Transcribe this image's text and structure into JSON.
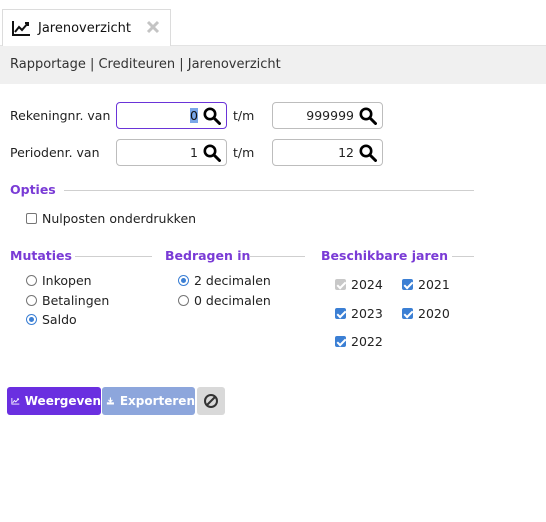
{
  "tab": {
    "title": "Jarenoverzicht",
    "icon": "chart-line-icon",
    "close_icon": "close-icon"
  },
  "breadcrumb": "Rapportage | Crediteuren | Jarenoverzicht",
  "filters": {
    "rekening": {
      "label": "Rekeningnr. van",
      "from": "0",
      "sep": "t/m",
      "to": "999999"
    },
    "periode": {
      "label": "Periodenr. van",
      "from": "1",
      "sep": "t/m",
      "to": "12"
    }
  },
  "opties": {
    "title": "Opties",
    "nulposten": {
      "label": "Nulposten onderdrukken",
      "checked": false
    }
  },
  "mutaties": {
    "title": "Mutaties",
    "options": [
      {
        "label": "Inkopen",
        "selected": false
      },
      {
        "label": "Betalingen",
        "selected": false
      },
      {
        "label": "Saldo",
        "selected": true
      }
    ]
  },
  "bedragen": {
    "title": "Bedragen in",
    "options": [
      {
        "label": "2 decimalen",
        "selected": true
      },
      {
        "label": "0 decimalen",
        "selected": false
      }
    ]
  },
  "jaren": {
    "title": "Beschikbare jaren",
    "years": [
      {
        "label": "2024",
        "checked": true,
        "disabled": true
      },
      {
        "label": "2021",
        "checked": true,
        "disabled": false
      },
      {
        "label": "2023",
        "checked": true,
        "disabled": false
      },
      {
        "label": "2020",
        "checked": true,
        "disabled": false
      },
      {
        "label": "2022",
        "checked": true,
        "disabled": false
      }
    ]
  },
  "buttons": {
    "weergeven": "Weergeven",
    "exporteren": "Exporteren",
    "reset_icon": "cancel-icon"
  },
  "colors": {
    "accent": "#6a2fe0",
    "section": "#7a3bd6",
    "secondary": "#8da6dc",
    "check": "#3b7fd4"
  }
}
